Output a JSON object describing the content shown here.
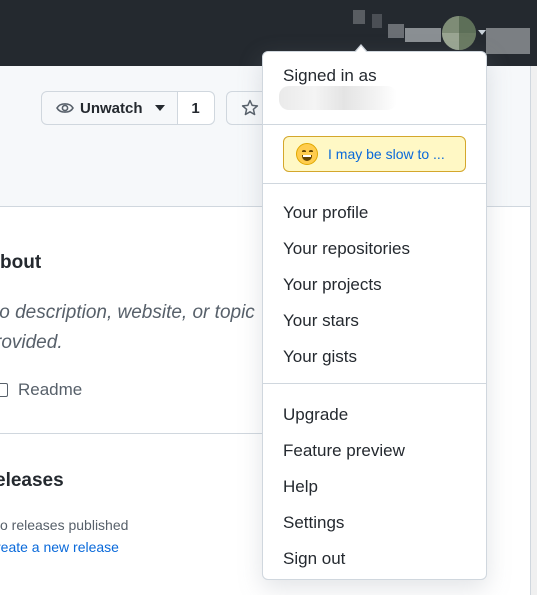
{
  "header": {
    "watch": {
      "label": "Unwatch",
      "count": "1"
    }
  },
  "sidebar": {
    "about": {
      "title": "bout",
      "description": "lo description, website, or topic rovided.",
      "readme_label": "Readme"
    },
    "releases": {
      "title": "eleases",
      "none_text": "o releases published",
      "create_link": "reate a new release"
    }
  },
  "dropdown": {
    "signed_in_label": "Signed in as",
    "status_text": "I may be slow to ...",
    "status_emoji": "grinning-face",
    "group1": [
      "Your profile",
      "Your repositories",
      "Your projects",
      "Your stars",
      "Your gists"
    ],
    "group2": [
      "Upgrade",
      "Feature preview",
      "Help",
      "Settings",
      "Sign out"
    ]
  },
  "colors": {
    "header_bg": "#24292f",
    "link": "#0969da",
    "status_bg": "#fff8c5",
    "status_border": "#d4a72c"
  }
}
